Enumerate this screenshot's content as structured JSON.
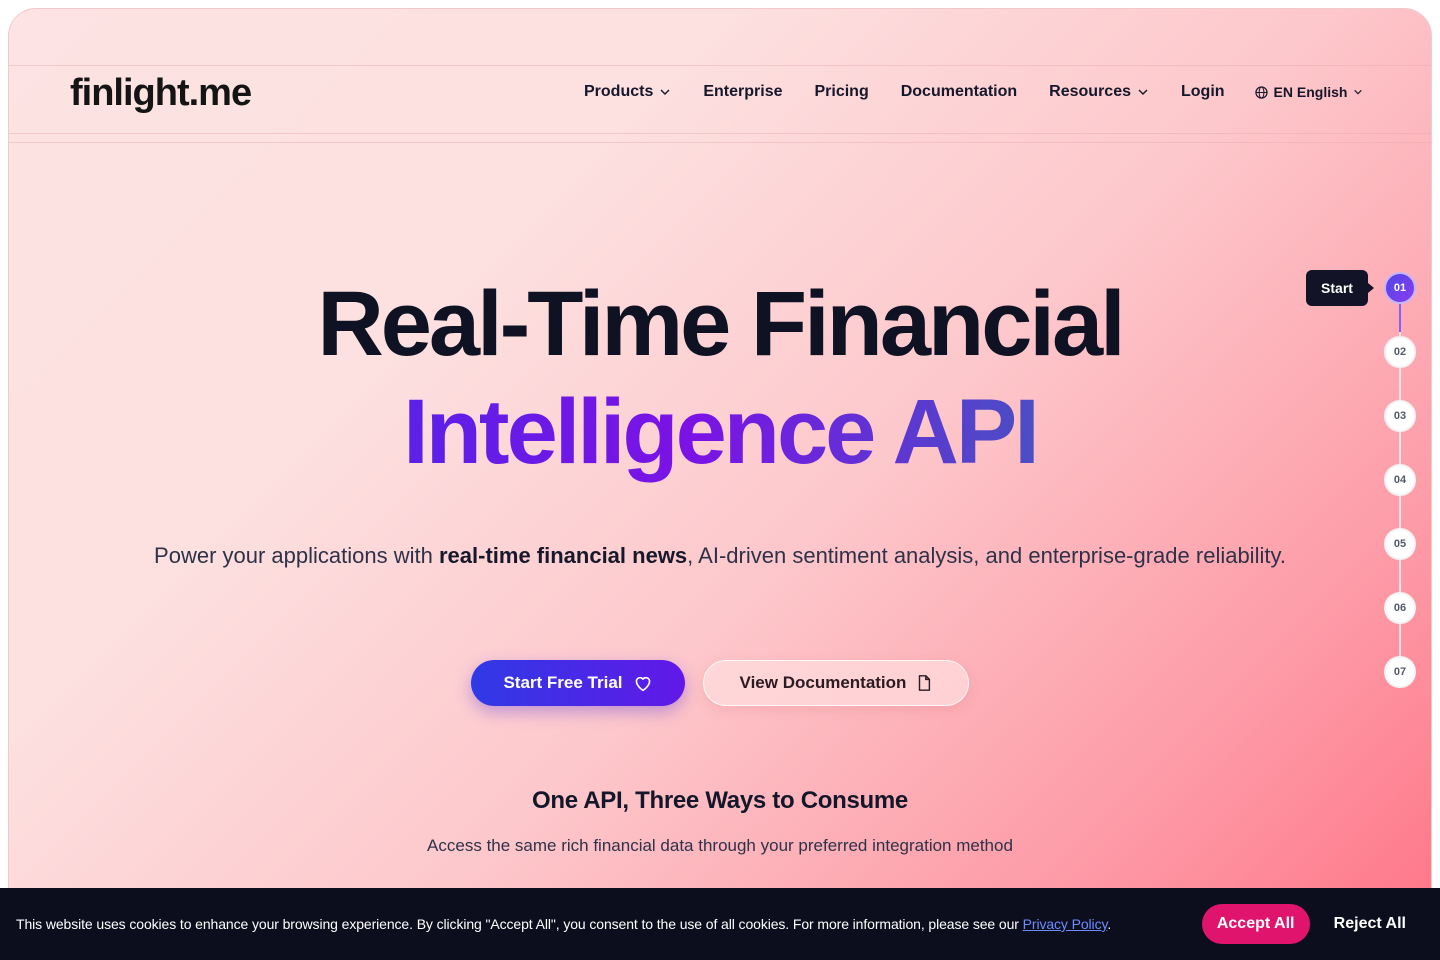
{
  "header": {
    "logo": "finlight.me",
    "nav": [
      {
        "label": "Products",
        "dropdown": true
      },
      {
        "label": "Enterprise",
        "dropdown": false
      },
      {
        "label": "Pricing",
        "dropdown": false
      },
      {
        "label": "Documentation",
        "dropdown": false
      },
      {
        "label": "Resources",
        "dropdown": true
      },
      {
        "label": "Login",
        "dropdown": false
      }
    ],
    "language": "EN English"
  },
  "hero": {
    "title_line1": "Real-Time Financial",
    "title_line2": "Intelligence API",
    "subtitle_pre": "Power your applications with ",
    "subtitle_bold": "real-time financial news",
    "subtitle_post": ", AI-driven sentiment analysis, and enterprise-grade reliability.",
    "primary_cta": "Start Free Trial",
    "secondary_cta": "View Documentation"
  },
  "section": {
    "title": "One API, Three Ways to Consume",
    "subtitle": "Access the same rich financial data through your preferred integration method"
  },
  "steps": {
    "tooltip": "Start",
    "items": [
      "01",
      "02",
      "03",
      "04",
      "05",
      "06",
      "07"
    ],
    "active_index": 0
  },
  "cookie": {
    "text": "This website uses cookies to enhance your browsing experience. By clicking \"Accept All\", you consent to the use of all cookies. For more information, please see our ",
    "link": "Privacy Policy",
    "text_end": ".",
    "accept": "Accept All",
    "reject": "Reject All"
  },
  "colors": {
    "accent_primary": "#2f3ae6",
    "accent_purple": "#6218e8",
    "accept_pink": "#e0136d",
    "cookie_bg": "#0c0e1d"
  }
}
